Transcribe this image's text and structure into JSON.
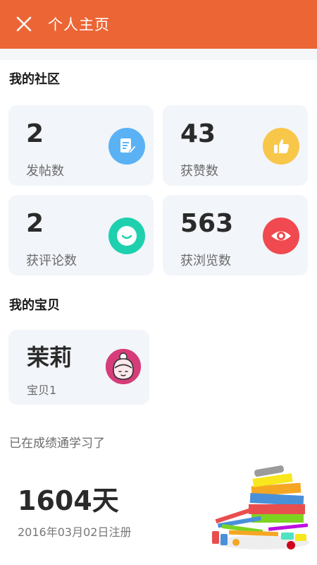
{
  "header": {
    "title": "个人主页",
    "close_icon": "close-icon"
  },
  "community": {
    "title": "我的社区",
    "stats": [
      {
        "value": "2",
        "label": "发帖数",
        "icon": "post-edit-icon",
        "color": "#5AB2F5"
      },
      {
        "value": "43",
        "label": "获赞数",
        "icon": "thumbs-up-icon",
        "color": "#F8C74A"
      },
      {
        "value": "2",
        "label": "获评论数",
        "icon": "comment-smile-icon",
        "color": "#1ED0AE"
      },
      {
        "value": "563",
        "label": "获浏览数",
        "icon": "eye-icon",
        "color": "#F04950"
      }
    ]
  },
  "babies": {
    "title": "我的宝贝",
    "items": [
      {
        "name": "茉莉",
        "sub": "宝贝1",
        "avatar_icon": "baby-avatar-icon",
        "avatar_color": "#D63C79"
      }
    ]
  },
  "learning": {
    "caption": "已在成绩通学习了",
    "days": "1604天",
    "registered": "2016年03月02日注册"
  },
  "colors": {
    "accent": "#EC6535",
    "card_bg": "#F2F5F9"
  }
}
